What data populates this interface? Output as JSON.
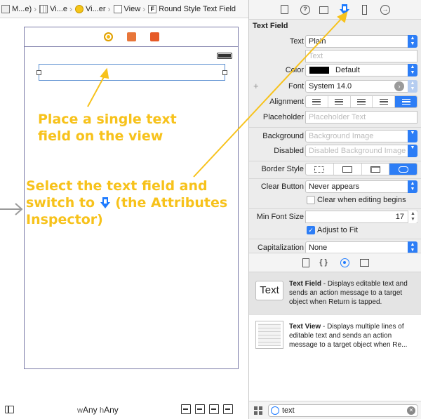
{
  "jumpbar": {
    "crumbs": [
      "M...e)",
      "Vi...e",
      "Vi...er",
      "View",
      "Round Style Text Field"
    ]
  },
  "canvas": {
    "annotation_1": "Place a single text field on the view",
    "annotation_2_before": "Select the text field and switch to",
    "annotation_2_after": "(the Attributes Inspector)",
    "size_class_w": "w",
    "size_class_any1": "Any",
    "size_class_h": "h",
    "size_class_any2": "Any"
  },
  "inspector": {
    "section_title": "Text Field",
    "text_label": "Text",
    "text_value": "Plain",
    "text_placeholder": "Text",
    "color_label": "Color",
    "color_value": "Default",
    "font_label": "Font",
    "font_value": "System 14.0",
    "alignment_label": "Alignment",
    "placeholder_label": "Placeholder",
    "placeholder_hint": "Placeholder Text",
    "background_label": "Background",
    "background_hint": "Background Image",
    "disabled_label": "Disabled",
    "disabled_hint": "Disabled Background Image",
    "border_style_label": "Border Style",
    "clear_button_label": "Clear Button",
    "clear_button_value": "Never appears",
    "clear_when_editing_label": "Clear when editing begins",
    "clear_when_editing_checked": false,
    "min_font_size_label": "Min Font Size",
    "min_font_size_value": "17",
    "adjust_to_fit_label": "Adjust to Fit",
    "adjust_to_fit_checked": true,
    "capitalization_label": "Capitalization",
    "capitalization_value": "None"
  },
  "library": {
    "items": [
      {
        "thumb": "Text",
        "title": "Text Field",
        "description": " - Displays editable text and sends an action message to a target object when Return is tapped."
      },
      {
        "thumb": "",
        "title": "Text View",
        "description": " - Displays multiple lines of editable text and sends an action message to a target object when Re..."
      }
    ]
  },
  "filter": {
    "value": "text"
  },
  "colors": {
    "annotation": "#f7c21b",
    "accent_blue": "#2c7df6",
    "selection_border": "#5b8fd1"
  },
  "icons": {
    "toolbar": [
      "file-inspector-icon",
      "quick-help-icon",
      "identity-inspector-icon",
      "attributes-inspector-icon",
      "size-inspector-icon",
      "connections-inspector-icon"
    ],
    "library_tabs": [
      "file-template-icon",
      "code-snippet-icon",
      "object-library-icon",
      "media-library-icon"
    ]
  }
}
